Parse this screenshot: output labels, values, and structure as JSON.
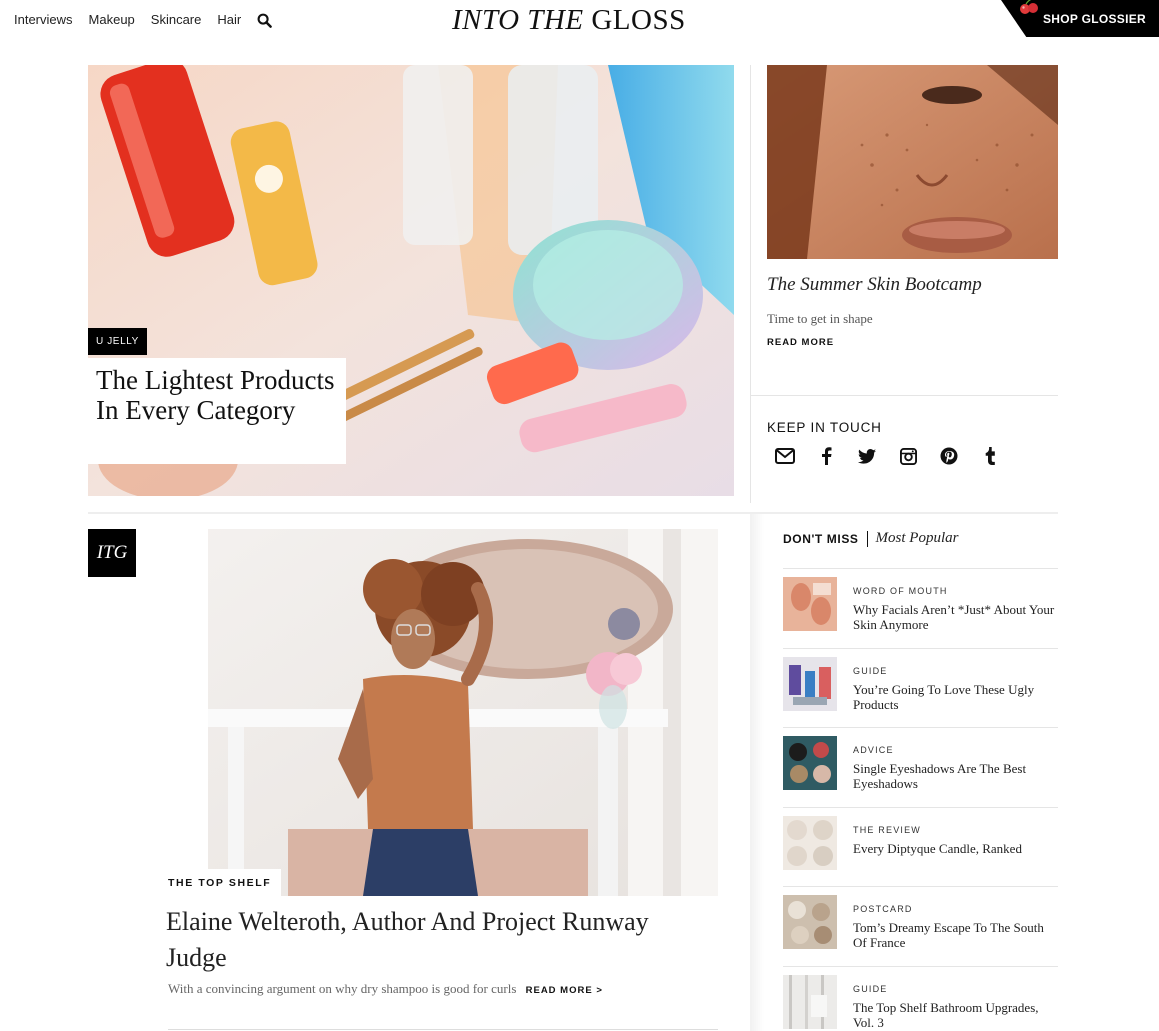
{
  "header": {
    "nav": [
      "Interviews",
      "Makeup",
      "Skincare",
      "Hair"
    ],
    "logo_italic": "INTO THE",
    "logo_roman": "GLOSS",
    "shop_label": "SHOP GLOSSIER"
  },
  "hero": {
    "tag": "U JELLY",
    "title": "The Lightest Products In Every Category"
  },
  "side_story": {
    "title": "The Summer Skin Bootcamp",
    "dek": "Time to get in shape",
    "read_more": "READ MORE"
  },
  "keep_in_touch": {
    "title": "KEEP IN TOUCH",
    "icons": [
      "envelope-icon",
      "facebook-icon",
      "twitter-icon",
      "instagram-icon",
      "pinterest-icon",
      "tumblr-icon"
    ]
  },
  "feature": {
    "badge": "ITG",
    "kicker": "THE TOP SHELF",
    "title": "Elaine Welteroth, Author And Project Runway Judge",
    "dek": "With a convincing argument on why dry shampoo is good for curls",
    "read_more": "READ MORE >"
  },
  "dont_miss": {
    "label": "DON'T MISS",
    "alt_label": "Most Popular",
    "items": [
      {
        "category": "WORD OF MOUTH",
        "title": "Why Facials Aren’t *Just* About Your Skin Anymore"
      },
      {
        "category": "GUIDE",
        "title": "You’re Going To Love These Ugly Products"
      },
      {
        "category": "ADVICE",
        "title": "Single Eyeshadows Are The Best Eyeshadows"
      },
      {
        "category": "THE REVIEW",
        "title": "Every Diptyque Candle, Ranked"
      },
      {
        "category": "POSTCARD",
        "title": "Tom’s Dreamy Escape To The South Of France"
      },
      {
        "category": "GUIDE",
        "title": "The Top Shelf Bathroom Upgrades, Vol. 3"
      }
    ]
  },
  "colors": {
    "black": "#000000",
    "text": "#111111",
    "muted": "#666666",
    "rule": "#e5e5e5"
  }
}
